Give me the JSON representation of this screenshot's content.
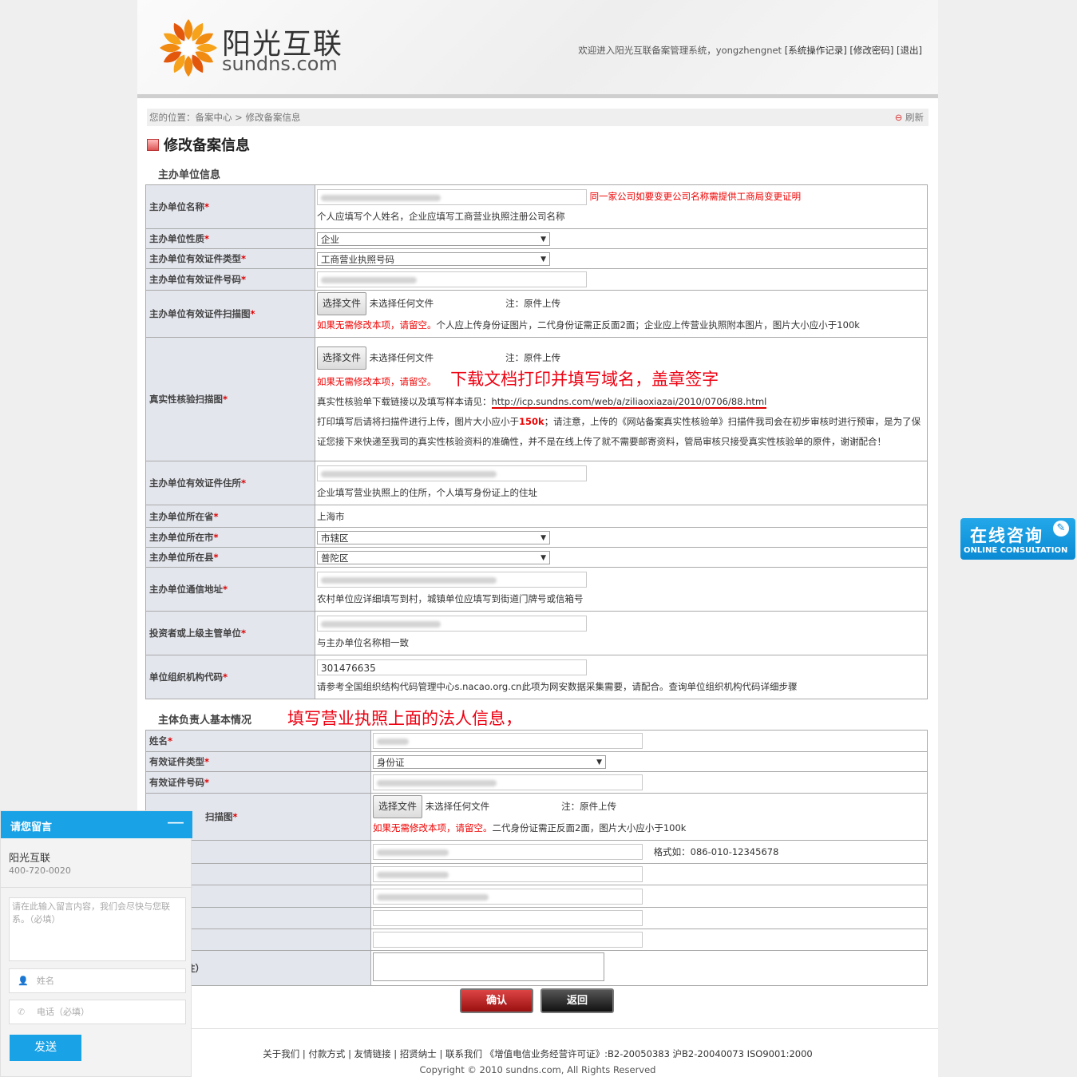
{
  "header": {
    "logo_cn": "阳光互联",
    "logo_en": "sundns.com",
    "welcome": "欢迎进入阳光互联备案管理系统，yongzhengnet ",
    "link_log": "[系统操作记录]",
    "link_pwd": "[修改密码]",
    "link_logout": "[退出]"
  },
  "breadcrumb": {
    "text": "您的位置：备案中心 > 修改备案信息",
    "refresh": "刷新"
  },
  "page_title": "修改备案信息",
  "section1_title": "主办单位信息",
  "section2_title": "主体负责人基本情况",
  "section2_annotation": "填写营业执照上面的法人信息，",
  "labels": {
    "org_name": "主办单位名称",
    "org_nature": "主办单位性质",
    "cert_type": "主办单位有效证件类型",
    "cert_no": "主办单位有效证件号码",
    "cert_scan": "主办单位有效证件扫描图",
    "verify_scan": "真实性核验扫描图",
    "cert_addr": "主办单位有效证件住所",
    "province": "主办单位所在省",
    "city": "主办单位所在市",
    "county": "主办单位所在县",
    "mail_addr": "主办单位通信地址",
    "investor": "投资者或上级主管单位",
    "org_code": "单位组织机构代码",
    "p_name": "姓名",
    "p_cert_type": "有效证件类型",
    "p_cert_no": "有效证件号码",
    "p_scan": "扫描图",
    "remark_tail": "注）"
  },
  "required_mark": "*",
  "values": {
    "org_name_note": "同一家公司如要变更公司名称需提供工商局变更证明",
    "org_name_hint": "个人应填写个人姓名，企业应填写工商营业执照注册公司名称",
    "org_nature": "企业",
    "cert_type": "工商营业执照号码",
    "choose_file": "选择文件",
    "no_file": "未选择任何文件",
    "original_note": "注：原件上传",
    "cert_scan_hint_red": "如果无需修改本项，请留空。",
    "cert_scan_hint": "个人应上传身份证图片，二代身份证需正反面2面；企业应上传营业执照附本图片，图片大小应小于100k",
    "verify_hint_red": "如果无需修改本项，请留空。",
    "verify_annotation": "下载文档打印并填写域名，盖章签字",
    "verify_link_prefix": "真实性核验单下载链接以及填写样本请见：",
    "verify_link": "http://icp.sundns.com/web/a/ziliaoxiazai/2010/0706/88.html",
    "verify_desc_1": "打印填写后请将扫描件进行上传，图片大小应小于",
    "verify_size": "150k",
    "verify_desc_2": "；请注意，上传的《网站备案真实性核验单》扫描件我司会在初步审核时进行预审，是为了保证您接下来快递至我司的真实性核验资料的准确性，并不是在线上传了就不需要邮寄资料，管局审核只接受真实性核验单的原件，谢谢配合！",
    "cert_addr_hint": "企业填写营业执照上的住所，个人填写身份证上的住址",
    "province": "上海市",
    "city": "市辖区",
    "county": "普陀区",
    "mail_addr_hint": "农村单位应详细填写到村，城镇单位应填写到街道门牌号或信箱号",
    "investor_hint": "与主办单位名称相一致",
    "org_code": "301476635",
    "org_code_hint": "请参考全国组织结构代码管理中心s.nacao.org.cn此项为网安数据采集需要，请配合。查询单位组织机构代码详细步骤",
    "p_cert_type": "身份证",
    "p_scan_hint_red": "如果无需修改本项，请留空。",
    "p_scan_hint": "二代身份证需正反面2面，图片大小应小于100k",
    "phone_format": "格式如：086-010-12345678"
  },
  "buttons": {
    "confirm": "确认",
    "back": "返回"
  },
  "footer": {
    "links": "关于我们 | 付款方式 | 友情链接 | 招贤纳士 | 联系我们 《增值电信业务经营许可证》:B2-20050383 沪B2-20040073 ISO9001:2000",
    "copyright": "Copyright © 2010 sundns.com, All Rights Reserved"
  },
  "consult": {
    "cn": "在线咨询",
    "en": "ONLINE CONSULTATION"
  },
  "chat": {
    "title": "请您留言",
    "minimize": "—",
    "company": "阳光互联",
    "phone": "400-720-0020",
    "message_placeholder": "请在此输入留言内容，我们会尽快与您联系。（必填）",
    "name_placeholder": "姓名",
    "phone_placeholder": "电话（必填）",
    "send": "发送"
  }
}
